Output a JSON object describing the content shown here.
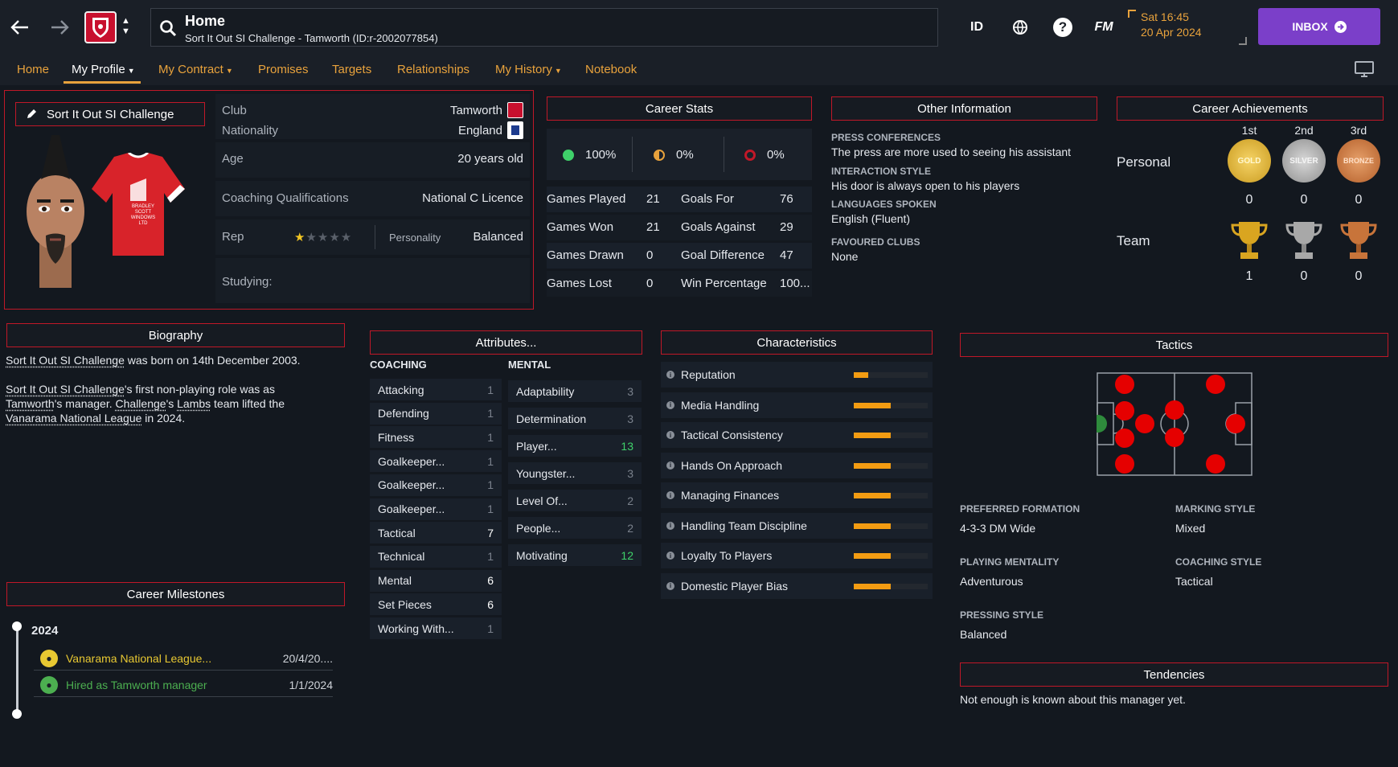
{
  "topbar": {
    "title": "Home",
    "subtitle": "Sort It Out SI Challenge - Tamworth (ID:r-2002077854)",
    "icons": [
      "back-arrow-icon",
      "forward-arrow-icon",
      "club-crest-icon",
      "search-icon",
      "id-icon",
      "globe-icon",
      "help-icon",
      "fm-icon",
      "inbox-arrow-icon"
    ],
    "id_label": "ID",
    "help_label": "?",
    "fm_label": "FM",
    "time": "Sat 16:45",
    "date": "20 Apr 2024",
    "inbox_label": "INBOX"
  },
  "nav": {
    "items": [
      {
        "label": "Home",
        "dropdown": false,
        "active": false
      },
      {
        "label": "My Profile",
        "dropdown": true,
        "active": true
      },
      {
        "label": "My Contract",
        "dropdown": true,
        "active": false
      },
      {
        "label": "Promises",
        "dropdown": false,
        "active": false
      },
      {
        "label": "Targets",
        "dropdown": false,
        "active": false
      },
      {
        "label": "Relationships",
        "dropdown": false,
        "active": false
      },
      {
        "label": "My History",
        "dropdown": true,
        "active": false
      },
      {
        "label": "Notebook",
        "dropdown": false,
        "active": false
      }
    ]
  },
  "profile": {
    "name": "Sort It Out SI Challenge",
    "club_label": "Club",
    "club": "Tamworth",
    "nationality_label": "Nationality",
    "nationality": "England",
    "age_label": "Age",
    "age": "20 years old",
    "coaching_label": "Coaching Qualifications",
    "coaching": "National C Licence",
    "rep_label": "Rep",
    "rep_stars": 1,
    "rep_max": 5,
    "personality_label": "Personality",
    "personality": "Balanced",
    "studying_label": "Studying:",
    "kit_text": "BRADLEY SCOTT WINDOWS LTD"
  },
  "career_stats": {
    "header": "Career Stats",
    "win_pct": "100%",
    "draw_pct": "0%",
    "loss_pct": "0%",
    "rows": [
      {
        "l1": "Games Played",
        "v1": "21",
        "l2": "Goals For",
        "v2": "76"
      },
      {
        "l1": "Games Won",
        "v1": "21",
        "l2": "Goals Against",
        "v2": "29"
      },
      {
        "l1": "Games Drawn",
        "v1": "0",
        "l2": "Goal Difference",
        "v2": "47"
      },
      {
        "l1": "Games Lost",
        "v1": "0",
        "l2": "Win Percentage",
        "v2": "100..."
      }
    ]
  },
  "other_info": {
    "header": "Other Information",
    "press_label": "PRESS CONFERENCES",
    "press": "The press are more used to seeing his assistant",
    "interaction_label": "INTERACTION STYLE",
    "interaction": "His door is always open to his players",
    "languages_label": "LANGUAGES SPOKEN",
    "languages": "English (Fluent)",
    "clubs_label": "FAVOURED CLUBS",
    "clubs": "None"
  },
  "achievements": {
    "header": "Career Achievements",
    "places": [
      "1st",
      "2nd",
      "3rd"
    ],
    "medals": [
      "GOLD",
      "SILVER",
      "BRONZE"
    ],
    "personal_label": "Personal",
    "personal": [
      "0",
      "0",
      "0"
    ],
    "team_label": "Team",
    "team": [
      "1",
      "0",
      "0"
    ]
  },
  "biography": {
    "header": "Biography",
    "name": "Sort It Out SI Challenge",
    "born_text": " was born on 14th December 2003.",
    "p2_name": "Sort It Out SI Challenge",
    "p2_a": "'s first non-playing role was as",
    "p2_club": "Tamworth",
    "p2_b": "'s manager. ",
    "p2_nick": "Challenge",
    "p2_c": "'s ",
    "p2_team": "Lambs",
    "p2_d": " team lifted the",
    "p2_league": "Vanarama National League",
    "p2_e": " in 2024."
  },
  "milestones": {
    "header": "Career Milestones",
    "year": "2024",
    "items": [
      {
        "text": "Vanarama National League...",
        "date": "20/4/20....",
        "icon": "trophy-icon",
        "color": "#e8c832"
      },
      {
        "text": "Hired as Tamworth manager",
        "date": "1/1/2024",
        "icon": "person-icon",
        "color": "#4caf50"
      }
    ]
  },
  "attributes": {
    "header": "Attributes...",
    "coaching_label": "COACHING",
    "mental_label": "MENTAL",
    "coaching": [
      {
        "name": "Attacking",
        "value": "1",
        "style": "dim"
      },
      {
        "name": "Defending",
        "value": "1",
        "style": "dim"
      },
      {
        "name": "Fitness",
        "value": "1",
        "style": "dim"
      },
      {
        "name": "Goalkeeper...",
        "value": "1",
        "style": "dim"
      },
      {
        "name": "Goalkeeper...",
        "value": "1",
        "style": "dim"
      },
      {
        "name": "Goalkeeper...",
        "value": "1",
        "style": "dim"
      },
      {
        "name": "Tactical",
        "value": "7",
        "style": "hi"
      },
      {
        "name": "Technical",
        "value": "1",
        "style": "dim"
      },
      {
        "name": "Mental",
        "value": "6",
        "style": "hi"
      },
      {
        "name": "Set Pieces",
        "value": "6",
        "style": "hi"
      },
      {
        "name": "Working With...",
        "value": "1",
        "style": "dim"
      }
    ],
    "mental": [
      {
        "name": "Adaptability",
        "value": "3",
        "style": "dim"
      },
      {
        "name": "Determination",
        "value": "3",
        "style": "dim"
      },
      {
        "name": "Player...",
        "value": "13",
        "style": "green"
      },
      {
        "name": "Youngster...",
        "value": "3",
        "style": "dim"
      },
      {
        "name": "Level Of...",
        "value": "2",
        "style": "dim"
      },
      {
        "name": "People...",
        "value": "2",
        "style": "dim"
      },
      {
        "name": "Motivating",
        "value": "12",
        "style": "green"
      }
    ]
  },
  "characteristics": {
    "header": "Characteristics",
    "items": [
      {
        "name": "Reputation",
        "level": 0.2
      },
      {
        "name": "Media Handling",
        "level": 0.5
      },
      {
        "name": "Tactical Consistency",
        "level": 0.5
      },
      {
        "name": "Hands On Approach",
        "level": 0.5
      },
      {
        "name": "Managing Finances",
        "level": 0.5
      },
      {
        "name": "Handling Team Discipline",
        "level": 0.5
      },
      {
        "name": "Loyalty To Players",
        "level": 0.5
      },
      {
        "name": "Domestic Player Bias",
        "level": 0.5
      }
    ]
  },
  "tactics": {
    "header": "Tactics",
    "formation_label": "PREFERRED FORMATION",
    "formation": "4-3-3 DM Wide",
    "marking_label": "MARKING STYLE",
    "marking": "Mixed",
    "mentality_label": "PLAYING MENTALITY",
    "mentality": "Adventurous",
    "coaching_label": "COACHING STYLE",
    "coaching": "Tactical",
    "pressing_label": "PRESSING STYLE",
    "pressing": "Balanced"
  },
  "tendencies": {
    "header": "Tendencies",
    "text": "Not enough is known about this manager yet."
  },
  "colors": {
    "accent": "#e8a23c",
    "frame": "#c01828",
    "inbox": "#7b3fc9",
    "bar": "#f39c12",
    "green": "#3fd16a"
  }
}
